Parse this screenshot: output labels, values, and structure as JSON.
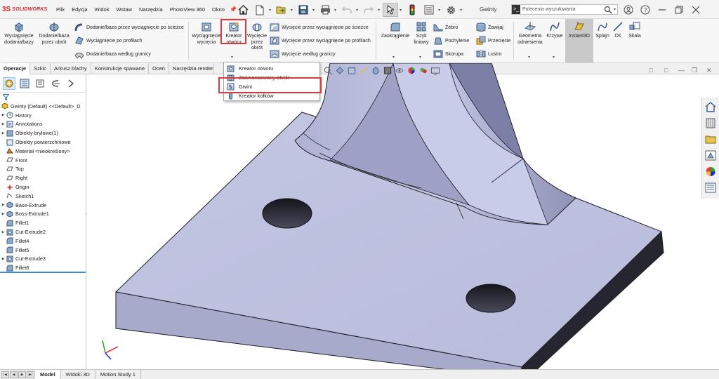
{
  "app": {
    "logo_mark": "3S",
    "logo_text": "SOLIDWORKS",
    "document_title": "Gwinty"
  },
  "menu": {
    "items": [
      "Plik",
      "Edycja",
      "Widok",
      "Wstaw",
      "Narzędzia",
      "PhotoView 360",
      "Okno"
    ]
  },
  "search": {
    "placeholder": "Polecenia wyszukiwania",
    "icon": "command-icon"
  },
  "ribbon": {
    "extrude_boss": "Wyciągnięcie dodania/bazy",
    "revolve_boss": "Dodanie/baza przez obrót",
    "swept_boss": "Dodanie/baza przez wyciągnięcie po ścieżce",
    "lofted_boss": "Wyciągnięcie po profilach",
    "boundary_boss": "Dodanie/baza według granicy",
    "extrude_cut": "Wyciągnięcie wycięcia",
    "hole_wizard": "Kreator otworu",
    "revolve_cut": "Wycięcie przez obrót",
    "swept_cut": "Wycięcie przez wyciągnięcie po ścieżce",
    "lofted_cut": "Wycięcie przez wyciągnięcie po profilach",
    "boundary_cut": "Wycięcie według granicy",
    "fillet": "Zaokrąglenie",
    "linear_pattern": "Szyk liniowy",
    "rib": "Żebro",
    "draft": "Pochylenie",
    "shell": "Skorupa",
    "wrap": "Zawijaj",
    "intersect": "Przecięcie",
    "mirror": "Lustro",
    "ref_geometry": "Geometria odniesienia",
    "curves": "Krzywe",
    "instant3d": "Instant3D",
    "spline": "Splajn",
    "axis": "Oś",
    "scale": "Skala"
  },
  "tabs": {
    "items": [
      "Operacje",
      "Szkic",
      "Arkusz blachy",
      "Konstrukcje spawane",
      "Oceń",
      "Narzędzia renderowania"
    ],
    "active": "Operacje"
  },
  "dropdown": {
    "items": [
      "Kreator otworu",
      "Zaawansowany otwór",
      "Gwint",
      "Kreator kołków"
    ],
    "highlighted": "Gwint"
  },
  "tree": {
    "root": "Gwinty  (Default) <<Default>_D",
    "items": [
      {
        "label": "History",
        "expand": true,
        "icon": "history-icon"
      },
      {
        "label": "Annotations",
        "expand": true,
        "icon": "annotations-icon"
      },
      {
        "label": "Obiekty bryłowe(1)",
        "expand": true,
        "icon": "solid-bodies-icon"
      },
      {
        "label": "Obiekty powierzchniowe",
        "expand": false,
        "icon": "surface-bodies-icon"
      },
      {
        "label": "Materiał <nieokreślony>",
        "expand": false,
        "icon": "material-icon"
      },
      {
        "label": "Front",
        "expand": false,
        "icon": "plane-icon"
      },
      {
        "label": "Top",
        "expand": false,
        "icon": "plane-icon"
      },
      {
        "label": "Right",
        "expand": false,
        "icon": "plane-icon"
      },
      {
        "label": "Origin",
        "expand": false,
        "icon": "origin-icon"
      },
      {
        "label": "Sketch1",
        "expand": false,
        "icon": "sketch-icon"
      },
      {
        "label": "Base-Extrude",
        "expand": true,
        "icon": "extrude-feature-icon"
      },
      {
        "label": "Boss-Extrude1",
        "expand": true,
        "icon": "extrude-feature-icon"
      },
      {
        "label": "Fillet1",
        "expand": false,
        "icon": "fillet-feature-icon"
      },
      {
        "label": "Cut-Extrude2",
        "expand": true,
        "icon": "cut-feature-icon"
      },
      {
        "label": "Fillet4",
        "expand": false,
        "icon": "fillet-feature-icon"
      },
      {
        "label": "Fillet5",
        "expand": false,
        "icon": "fillet-feature-icon"
      },
      {
        "label": "Cut-Extrude3",
        "expand": true,
        "icon": "cut-feature-icon"
      },
      {
        "label": "Fillet6",
        "expand": false,
        "icon": "fillet-feature-icon"
      }
    ]
  },
  "bottom_tabs": {
    "items": [
      "Model",
      "Widoki 3D",
      "Motion Study 1"
    ],
    "active": "Model"
  },
  "colors": {
    "accent_red": "#d83b3f",
    "part_face": "#c9cce6",
    "part_dark": "#2a2a35",
    "selection_blue": "#3a8fd6"
  }
}
